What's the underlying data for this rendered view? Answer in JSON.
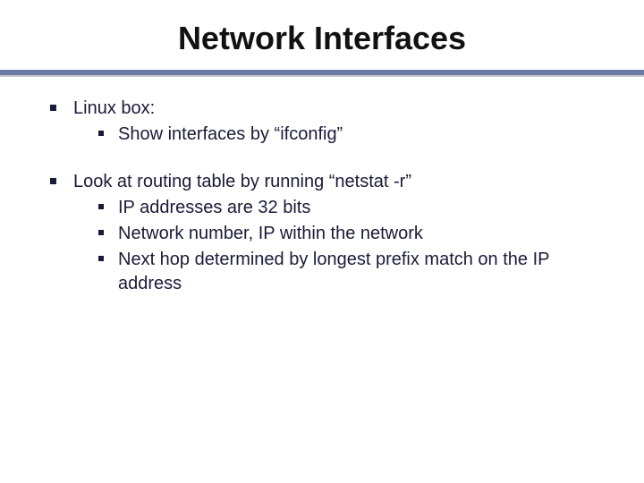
{
  "title": "Network Interfaces",
  "bullets": [
    {
      "text": "Linux box:",
      "sub": [
        {
          "text": "Show interfaces by “ifconfig”"
        }
      ]
    },
    {
      "text": "Look at routing table by running “netstat -r”",
      "sub": [
        {
          "text": "IP addresses are 32 bits"
        },
        {
          "text": "Network number, IP within the network"
        },
        {
          "text": "Next hop determined by longest prefix match on the IP address"
        }
      ]
    }
  ]
}
